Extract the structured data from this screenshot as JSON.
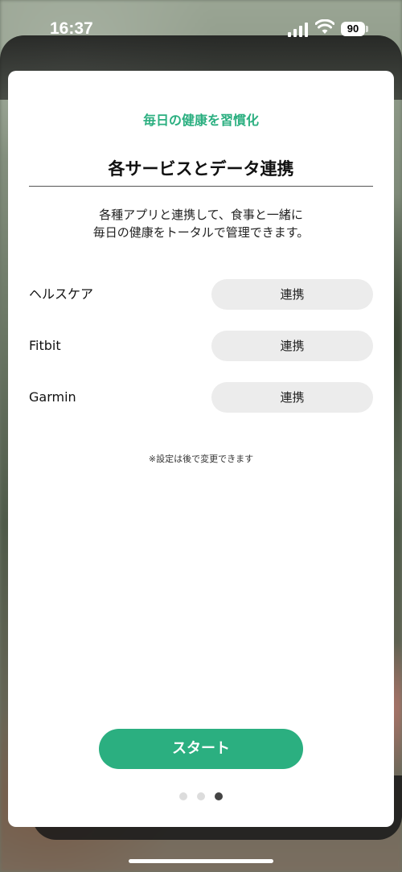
{
  "status_bar": {
    "time": "16:37",
    "battery": "90",
    "icons": [
      "cellular-signal-icon",
      "wifi-icon",
      "battery-icon"
    ]
  },
  "onboarding": {
    "subtitle": "毎日の健康を習慣化",
    "title": "各サービスとデータ連携",
    "description_line1": "各種アプリと連携して、食事と一緒に",
    "description_line2": "毎日の健康をトータルで管理できます。",
    "services": [
      {
        "name": "ヘルスケア",
        "button_label": "連携"
      },
      {
        "name": "Fitbit",
        "button_label": "連携"
      },
      {
        "name": "Garmin",
        "button_label": "連携"
      }
    ],
    "note": "※設定は後で変更できます",
    "start_label": "スタート",
    "pagination": {
      "total": 3,
      "current": 3
    }
  },
  "colors": {
    "accent": "#2baf80",
    "button_bg": "#ececec",
    "dot_active": "#444444",
    "dot_inactive": "#dcdcdc"
  }
}
